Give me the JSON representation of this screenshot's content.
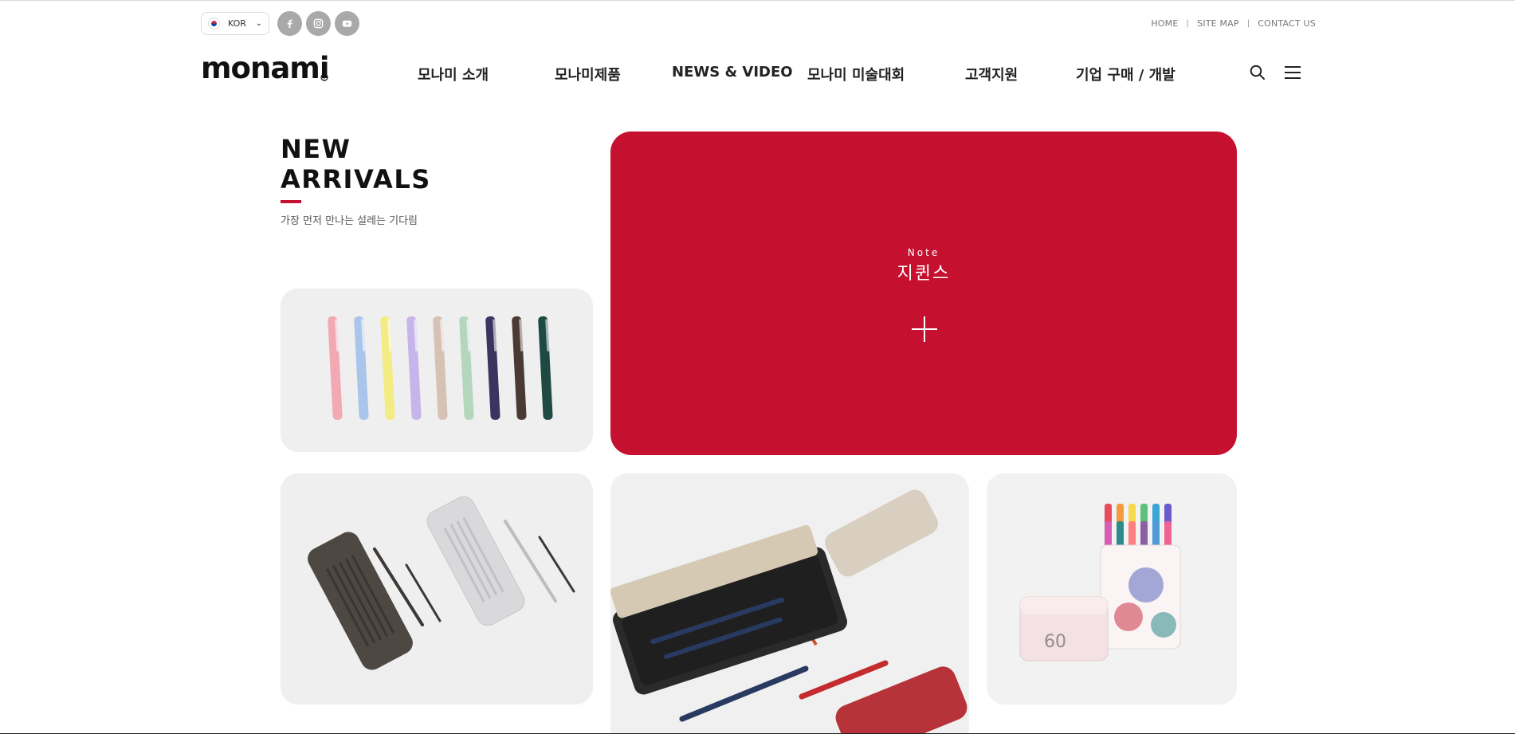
{
  "topbar": {
    "language": "KOR",
    "social": [
      {
        "icon": "facebook-icon"
      },
      {
        "icon": "instagram-icon"
      },
      {
        "icon": "youtube-icon"
      }
    ],
    "links": [
      "HOME",
      "SITE MAP",
      "CONTACT US"
    ],
    "separator": "|"
  },
  "header": {
    "logo_text": "monami",
    "nav": [
      "모나미 소개",
      "모나미제품",
      "NEWS & VIDEO",
      "모나미 미술대회",
      "고객지원",
      "기업 구매 / 개발"
    ],
    "icons": [
      "search-icon",
      "menu-icon"
    ]
  },
  "new_arrivals": {
    "title_line1": "NEW",
    "title_line2": "ARRIVALS",
    "subtitle": "가장 먼저 만나는 설레는 기다림",
    "accent_color": "#c5112f",
    "featured": {
      "category": "Note",
      "name": "지퀸스",
      "background": "#c5112f"
    },
    "products": [
      {
        "image": "multi-color-pens"
      },
      {
        "image": "pen-cases-with-pens"
      },
      {
        "image": "tin-case-fountain-pens"
      },
      {
        "image": "marker-set-60"
      }
    ],
    "marker_box_number": "60"
  }
}
